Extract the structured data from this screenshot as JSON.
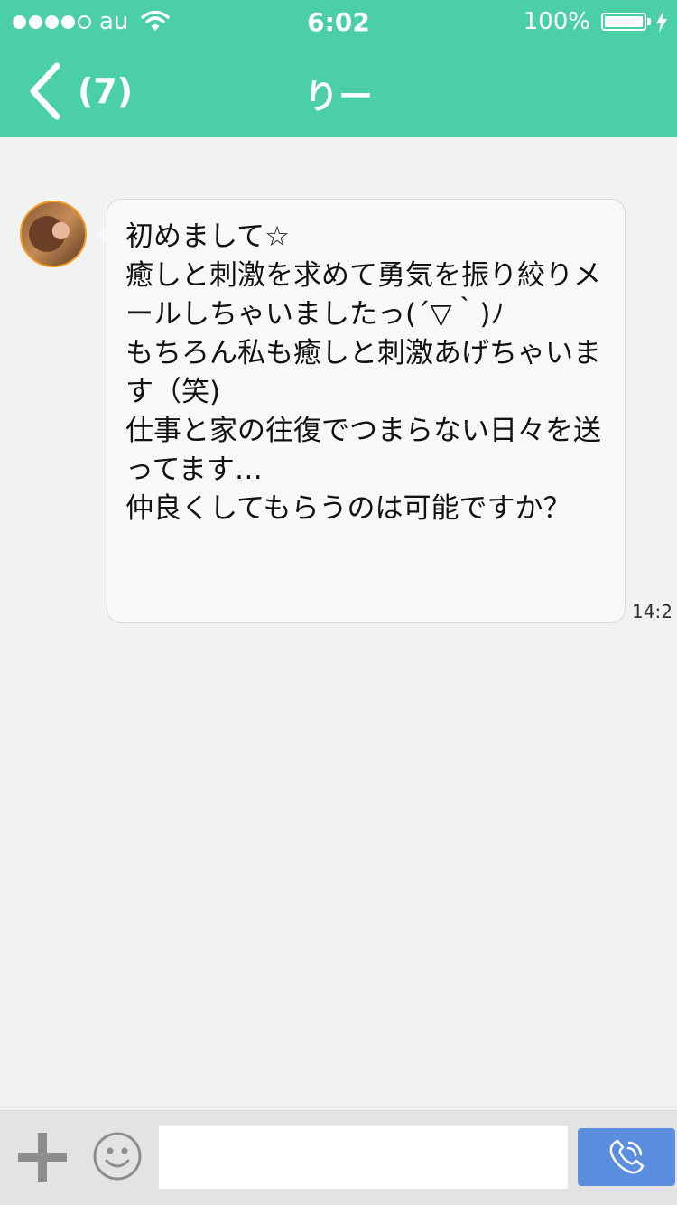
{
  "status_bar": {
    "signal_dots_filled": 4,
    "signal_dots_total": 5,
    "carrier": "au",
    "time": "6:02",
    "battery_percent": "100%",
    "battery_level": 1.0
  },
  "navbar": {
    "back_count": "(7)",
    "title": "りー"
  },
  "message": {
    "text": "初めまして☆\n癒しと刺激を求めて勇気を振り絞りメールしちゃいましたっ(´▽｀)ﾉ\nもちろん私も癒しと刺激あげちゃいます（笑)\n仕事と家の往復でつまらない日々を送ってます…\n仲良くしてもらうのは可能ですか？",
    "timestamp": "14:2"
  },
  "input_bar": {
    "input_value": "",
    "icons": [
      "plus-icon",
      "smiley-icon",
      "phone-icon"
    ]
  },
  "colors": {
    "header": "#4bcfa6",
    "call_button": "#5c8ee0",
    "avatar_border": "#f29b21"
  }
}
